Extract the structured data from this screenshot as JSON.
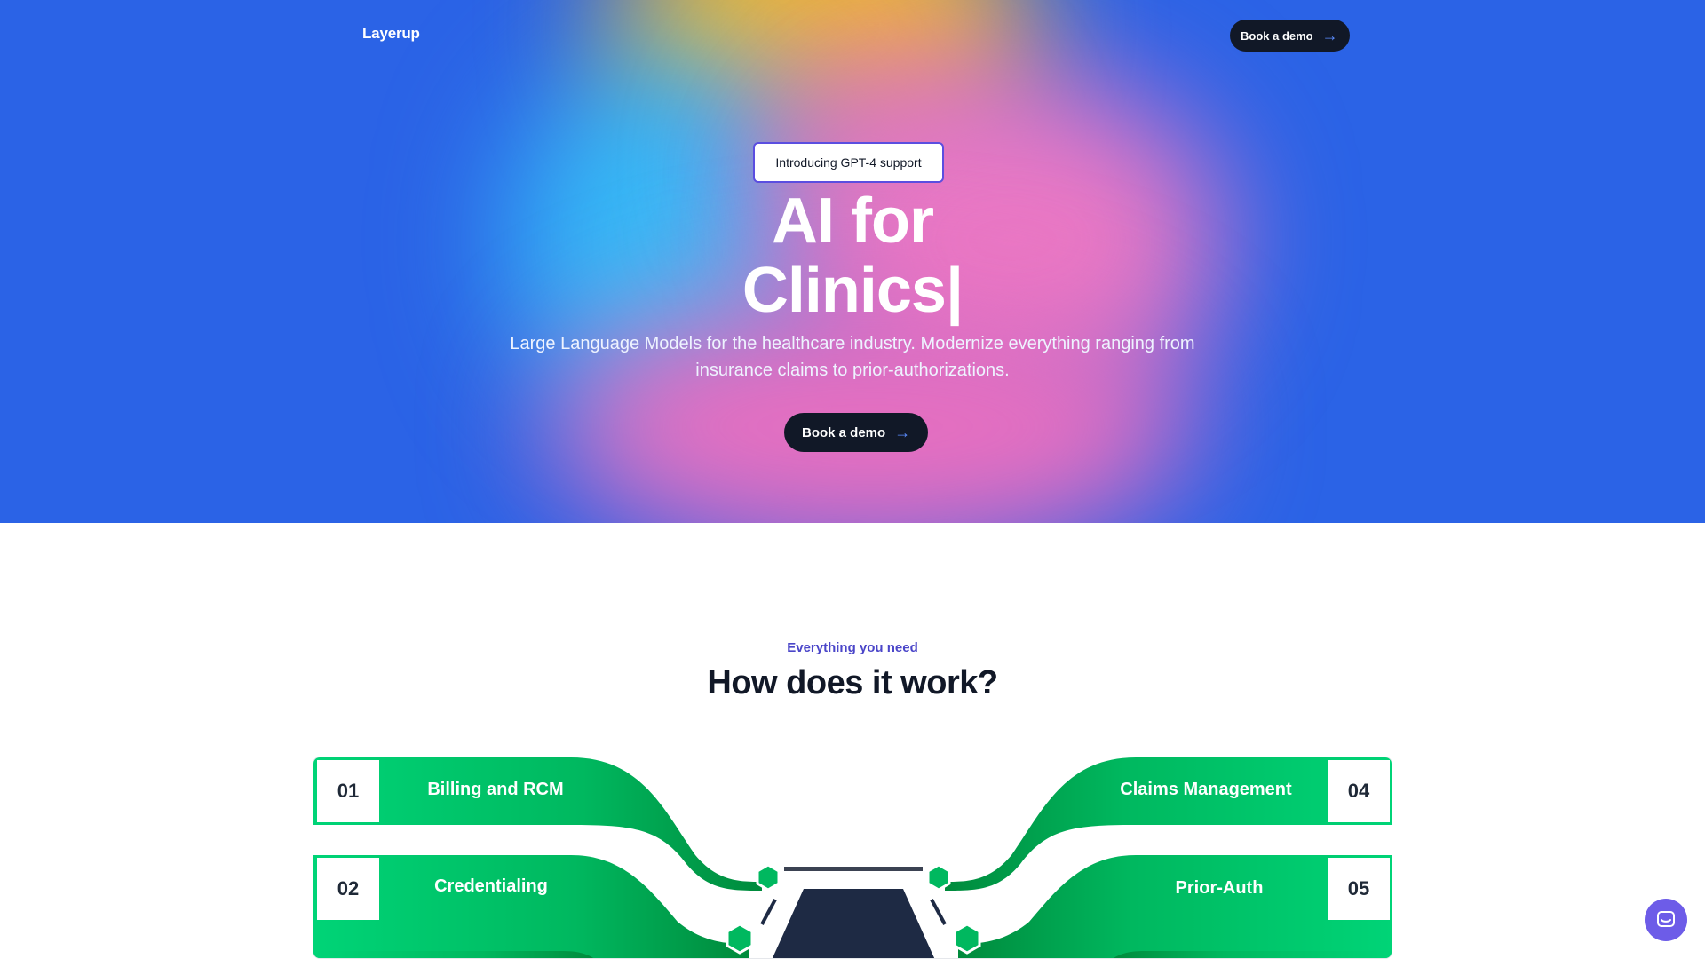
{
  "brand": {
    "logo": "Layerup"
  },
  "nav": {
    "cta_label": "Book a demo",
    "cta_icon": "arrow-right-icon"
  },
  "hero": {
    "badge": "Introducing GPT-4 support",
    "headline_line1": "AI for",
    "headline_line2": "Clinics|",
    "subtext": "Large Language Models for the healthcare industry. Modernize everything ranging from insurance claims to prior-authorizations.",
    "cta_label": "Book a demo"
  },
  "section": {
    "eyebrow": "Everything you need",
    "title": "How does it work?"
  },
  "diagram": {
    "left_rows": [
      {
        "number": "01",
        "label": "Billing and RCM"
      },
      {
        "number": "02",
        "label": "Credentialing"
      }
    ],
    "right_rows": [
      {
        "number": "04",
        "label": "Claims Management"
      },
      {
        "number": "05",
        "label": "Prior-Auth"
      }
    ]
  },
  "chat": {
    "icon": "chat-icon"
  },
  "colors": {
    "hero_blue": "#2b63e6",
    "brand_green": "#00c96f",
    "dark_green": "#008a3c",
    "navy": "#1e2a44",
    "accent_purple": "#4b46c9"
  }
}
